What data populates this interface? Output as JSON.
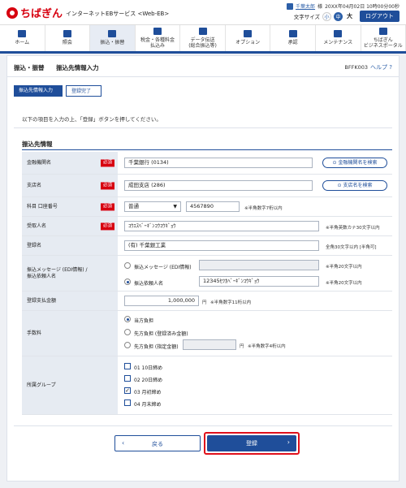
{
  "header": {
    "logo_text": "ちばぎん",
    "service_name": "インターネットEBサービス <Web-EB>",
    "user_name": "千葉太郎",
    "user_suffix": "様",
    "login_time": "20XX年04月02日 10時00分00秒",
    "font_size_label": "文字サイズ",
    "font_small": "小",
    "font_medium": "中",
    "font_large": "大",
    "logout_label": "ログアウト"
  },
  "nav": {
    "items": [
      {
        "label": "ホーム",
        "icon": "home-icon"
      },
      {
        "label": "照会",
        "icon": "document-icon"
      },
      {
        "label": "振込・振替",
        "icon": "transfer-icon",
        "active": true
      },
      {
        "label": "税金・各種料金\n払込み",
        "icon": "tax-icon"
      },
      {
        "label": "データ伝送\n(総合振込等)",
        "icon": "data-icon"
      },
      {
        "label": "オプション",
        "icon": "option-icon"
      },
      {
        "label": "承認",
        "icon": "approve-icon"
      },
      {
        "label": "メンテナンス",
        "icon": "maintenance-icon"
      },
      {
        "label": "ちばぎん\nビジネスポータル",
        "icon": "portal-icon"
      }
    ]
  },
  "page": {
    "breadcrumb_1": "振込・振替",
    "breadcrumb_2": "振込先情報入力",
    "screen_id": "BFFK003",
    "help_label": "ヘルプ",
    "step_1": "振込先情報入力",
    "step_2": "登録完了",
    "instruction": "以下の項目を入力の上、「登録」ボタンを押してください。",
    "section_title": "振込先情報"
  },
  "form": {
    "required_label": "必須",
    "bank": {
      "label": "金融機関名",
      "value": "千葉銀行 (0134)",
      "button": "金融機関名を検索"
    },
    "branch": {
      "label": "支店名",
      "value": "成田支店 (286)",
      "button": "支店名を検索"
    },
    "account": {
      "label": "科目 口座番号",
      "type": "普通",
      "number": "4567890",
      "note": "※半角数字7桁以内"
    },
    "recipient": {
      "label": "受取人名",
      "value": "ｺｳｴｽﾍﾞｰｷﾞﾝｺｳｺｳｷﾞｮｳ",
      "note": "※半角英数カナ30文字以内"
    },
    "reg_name": {
      "label": "登録名",
      "value": "(有) 千葉銀工業",
      "note": "全角30文字以内 [半角可]"
    },
    "edi": {
      "label_line1": "振込メッセージ (EDI情報) /",
      "label_line2": "振込依頼人名",
      "opt1": "振込メッセージ (EDI情報)",
      "opt1_note": "※半角20文字以内",
      "opt2": "振込依頼人名",
      "opt2_value": "12345ｾﾂｶﾍﾞｰｷﾞﾝｺｳｷﾞｮｳ",
      "opt2_note": "※半角20文字以内"
    },
    "amount": {
      "label": "登録支払金額",
      "value": "1,000,000",
      "unit": "円",
      "note": "※半角数字11桁以内"
    },
    "fee": {
      "label": "手数料",
      "opt1": "当方負担",
      "opt2": "先方負担 (登録済み金額)",
      "opt3": "先方負担 (指定金額)",
      "unit": "円",
      "note": "※半角数字4桁以内"
    },
    "group": {
      "label": "所属グループ",
      "options": [
        "01 10日締め",
        "02 20日締め",
        "03 月初締め",
        "04 月末締め"
      ]
    }
  },
  "buttons": {
    "back": "戻る",
    "submit": "登録"
  }
}
